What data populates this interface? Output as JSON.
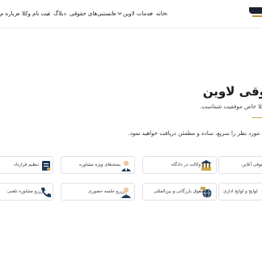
{
  "nav": {
    "items": [
      {
        "label": "خانه"
      },
      {
        "label": "خدمات لاوین"
      },
      {
        "label": "دانستنی‌های حقوقی"
      },
      {
        "label": "بلاگ"
      },
      {
        "label": "ثبت نام وکلا"
      },
      {
        "label": "درباره م"
      }
    ],
    "chevron": "chevron-down-icon"
  },
  "hero": {
    "title": "وقی لاوین",
    "subtitle": "وکلا خاص موفقیت شماست.",
    "description": "ت مورد نظر را سریع، ساده و مطمئن دریافت خواهید نمود."
  },
  "services": [
    {
      "label": "حقوقی آنلاین",
      "icon": "lawyer-icon"
    },
    {
      "label": "وکالت در دادگاه",
      "icon": "courthouse-icon"
    },
    {
      "label": "بسته‌های ویژه مشاوره",
      "icon": "consultant-icon"
    },
    {
      "label": "تنظیم قرارداد",
      "icon": "document-icon"
    },
    {
      "label": "لوایح و لوایح اداری",
      "icon": "lawyer-icon"
    },
    {
      "label": "حقوق بازرگانی و بین‌المللی",
      "icon": "globe-icon"
    },
    {
      "label": "رزرو جلسه حضوری",
      "icon": "meeting-icon"
    },
    {
      "label": "رزرو مشاوره تلفنی",
      "icon": "phone-icon"
    }
  ],
  "colors": {
    "accent": "#c9a84a",
    "brand": "#1a2230",
    "navy": "#1f3a5a"
  }
}
